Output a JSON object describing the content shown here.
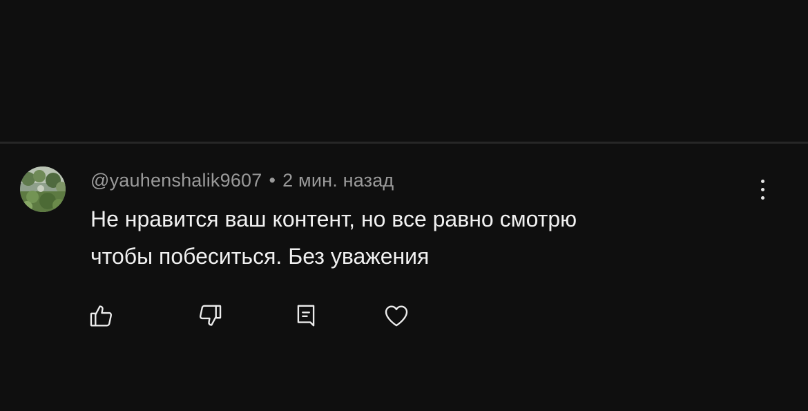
{
  "comment": {
    "author": "@yauhenshalik9607",
    "separator": "•",
    "time": "2 мин. назад",
    "lines": [
      "Не нравится ваш контент, но все равно смотрю",
      "чтобы побеситься. Без уважения"
    ]
  },
  "icons": {
    "avatar": "avatar-photo",
    "more": "more-vert-icon",
    "like": "thumb-up-icon",
    "dislike": "thumb-down-icon",
    "reply": "reply-icon",
    "heart": "heart-icon"
  },
  "colors": {
    "background": "#0f0f0f",
    "text": "#f1f1f1",
    "meta": "#9a9a9a",
    "divider": "#272727"
  }
}
